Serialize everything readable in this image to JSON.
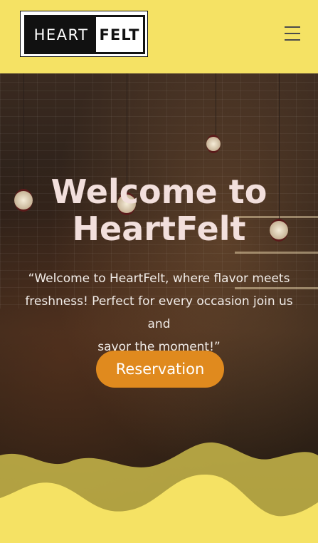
{
  "header": {
    "logo_left": "HEART",
    "logo_right": "FELT"
  },
  "hero": {
    "title_line1": "Welcome to",
    "title_line2": "HeartFelt",
    "tagline_line1": "“Welcome to HeartFelt, where flavor meets",
    "tagline_line2": "freshness! Perfect for every occasion join us and",
    "tagline_line3": "savor the moment!”",
    "cta_label": "Reservation"
  },
  "colors": {
    "header_bg": "#f5e264",
    "button_bg": "#e08a1e",
    "wave_yellow": "#f5e264",
    "wave_olive": "#c9b94a"
  },
  "icons": {
    "menu": "hamburger-menu-icon"
  }
}
